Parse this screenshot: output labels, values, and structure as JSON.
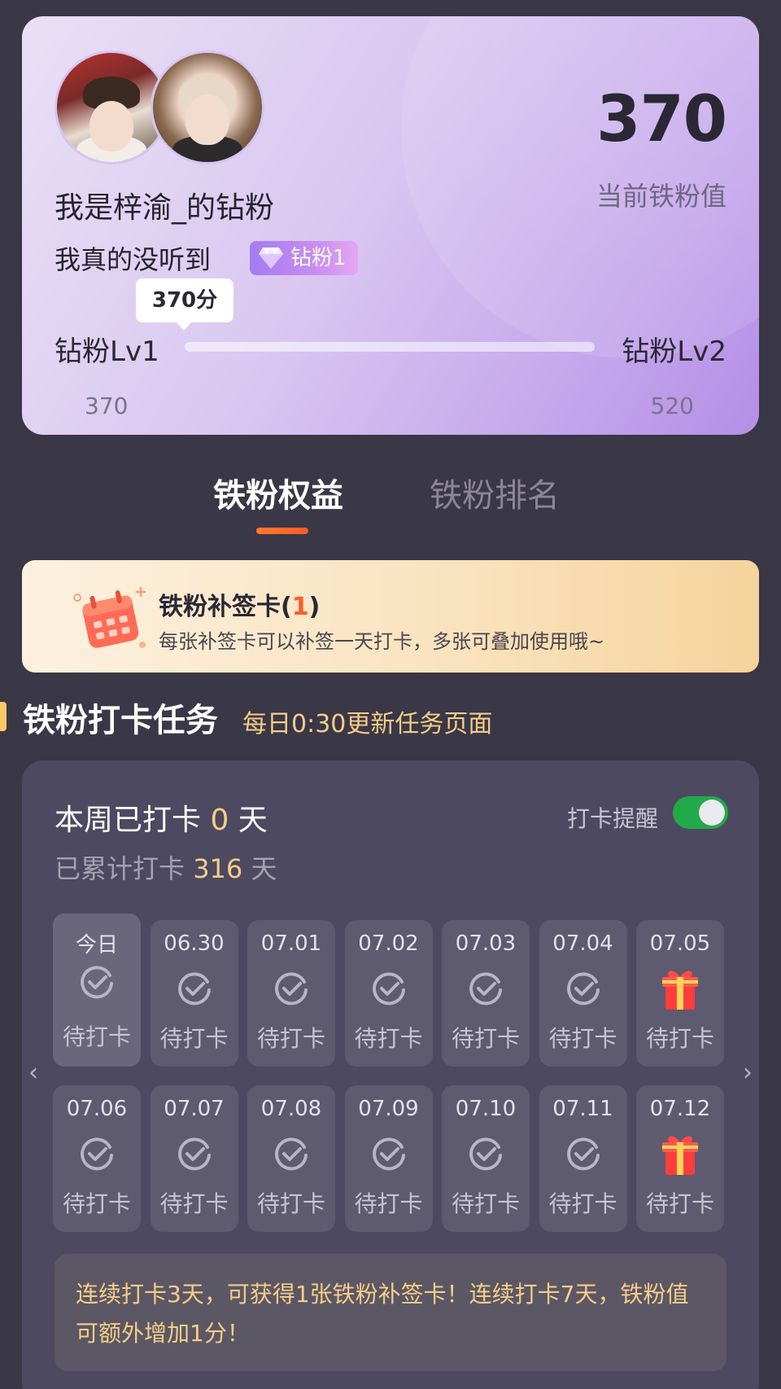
{
  "profile": {
    "username": "我是梓渝_的钻粉",
    "tagline": "我真的没听到",
    "badge_label": "钻粉1",
    "score": "370",
    "score_label": "当前铁粉值",
    "progress": {
      "tooltip": "370分",
      "current_level": "钻粉Lv1",
      "next_level": "钻粉Lv2",
      "current_value": "370",
      "next_value": "520",
      "fill_fraction": 0
    }
  },
  "tabs": [
    {
      "label": "铁粉权益",
      "active": true
    },
    {
      "label": "铁粉排名",
      "active": false
    }
  ],
  "resign_card": {
    "title": "铁粉补签卡(",
    "count": "1",
    "title_end": ")",
    "description": "每张补签卡可以补签一天打卡，多张可叠加使用哦~"
  },
  "section": {
    "title": "铁粉打卡任务",
    "subtitle": "每日0:30更新任务页面"
  },
  "checkin": {
    "week_prefix": "本周已打卡 ",
    "week_days": "0",
    "week_suffix": " 天",
    "total_prefix": "已累计打卡 ",
    "total_days": "316",
    "total_suffix": " 天",
    "reminder_label": "打卡提醒",
    "reminder_on": true,
    "days": [
      {
        "date": "今日",
        "status": "待打卡",
        "icon": "check-circle-icon"
      },
      {
        "date": "06.30",
        "status": "待打卡",
        "icon": "check-circle-icon"
      },
      {
        "date": "07.01",
        "status": "待打卡",
        "icon": "check-circle-icon"
      },
      {
        "date": "07.02",
        "status": "待打卡",
        "icon": "check-circle-icon"
      },
      {
        "date": "07.03",
        "status": "待打卡",
        "icon": "check-circle-icon"
      },
      {
        "date": "07.04",
        "status": "待打卡",
        "icon": "check-circle-icon"
      },
      {
        "date": "07.05",
        "status": "待打卡",
        "icon": "gift-icon"
      },
      {
        "date": "07.06",
        "status": "待打卡",
        "icon": "check-circle-icon"
      },
      {
        "date": "07.07",
        "status": "待打卡",
        "icon": "check-circle-icon"
      },
      {
        "date": "07.08",
        "status": "待打卡",
        "icon": "check-circle-icon"
      },
      {
        "date": "07.09",
        "status": "待打卡",
        "icon": "check-circle-icon"
      },
      {
        "date": "07.10",
        "status": "待打卡",
        "icon": "check-circle-icon"
      },
      {
        "date": "07.11",
        "status": "待打卡",
        "icon": "check-circle-icon"
      },
      {
        "date": "07.12",
        "status": "待打卡",
        "icon": "gift-icon"
      }
    ],
    "notice": "连续打卡3天，可获得1张铁粉补签卡！连续打卡7天，铁粉值可额外增加1分！"
  },
  "colors": {
    "background": "#3a3747",
    "accent_gold": "#f5cd88",
    "accent_orange": "#ff5a2a",
    "toggle_on": "#22a94a"
  }
}
